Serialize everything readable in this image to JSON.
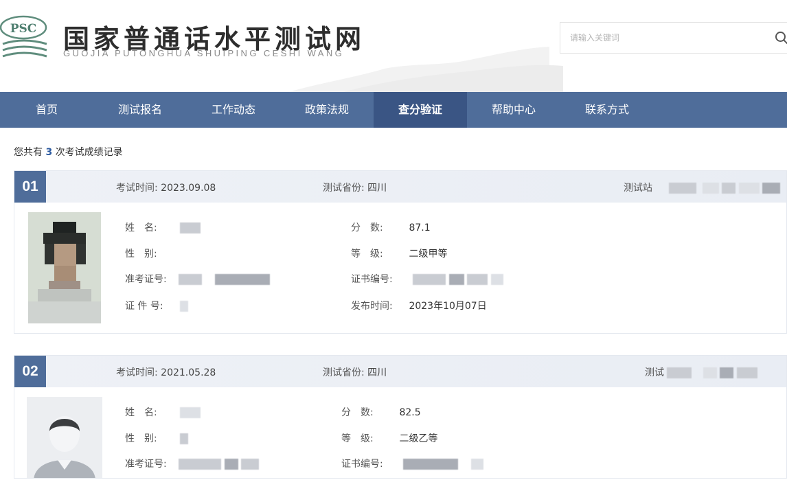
{
  "header": {
    "logo_text": "PSC",
    "title": "国家普通话水平测试网",
    "subtitle": "GUOJIA PUTONGHUA SHUIPING CESHI WANG",
    "search": {
      "placeholder": "请输入关键词"
    }
  },
  "nav": {
    "items": [
      {
        "label": "首页"
      },
      {
        "label": "测试报名"
      },
      {
        "label": "工作动态"
      },
      {
        "label": "政策法规"
      },
      {
        "label": "查分验证",
        "active": true
      },
      {
        "label": "帮助中心"
      },
      {
        "label": "联系方式"
      }
    ]
  },
  "summary": {
    "prefix": "您共有",
    "count": "3",
    "suffix": "次考试成绩记录"
  },
  "records": [
    {
      "index": "01",
      "exam_time_label": "考试时间:",
      "exam_time": "2023.09.08",
      "province_label": "测试省份:",
      "province": "四川",
      "station_label": "测试站",
      "name_label": "姓　名:",
      "gender_label": "性　别:",
      "admission_label": "准考证号:",
      "id_label": "证 件 号:",
      "score_label": "分　数:",
      "score": "87.1",
      "level_label": "等　级:",
      "level": "二级甲等",
      "cert_label": "证书编号:",
      "publish_label": "发布时间:",
      "publish_time": "2023年10月07日"
    },
    {
      "index": "02",
      "exam_time_label": "考试时间:",
      "exam_time": "2021.05.28",
      "province_label": "测试省份:",
      "province": "四川",
      "station_label": "测试",
      "name_label": "姓　名:",
      "gender_label": "性　别:",
      "admission_label": "准考证号:",
      "score_label": "分　数:",
      "score": "82.5",
      "level_label": "等　级:",
      "level": "二级乙等",
      "cert_label": "证书编号:"
    }
  ],
  "colors": {
    "nav": "#4f6d9a",
    "nav_active": "#3a5584",
    "accent": "#2c5aa0"
  }
}
